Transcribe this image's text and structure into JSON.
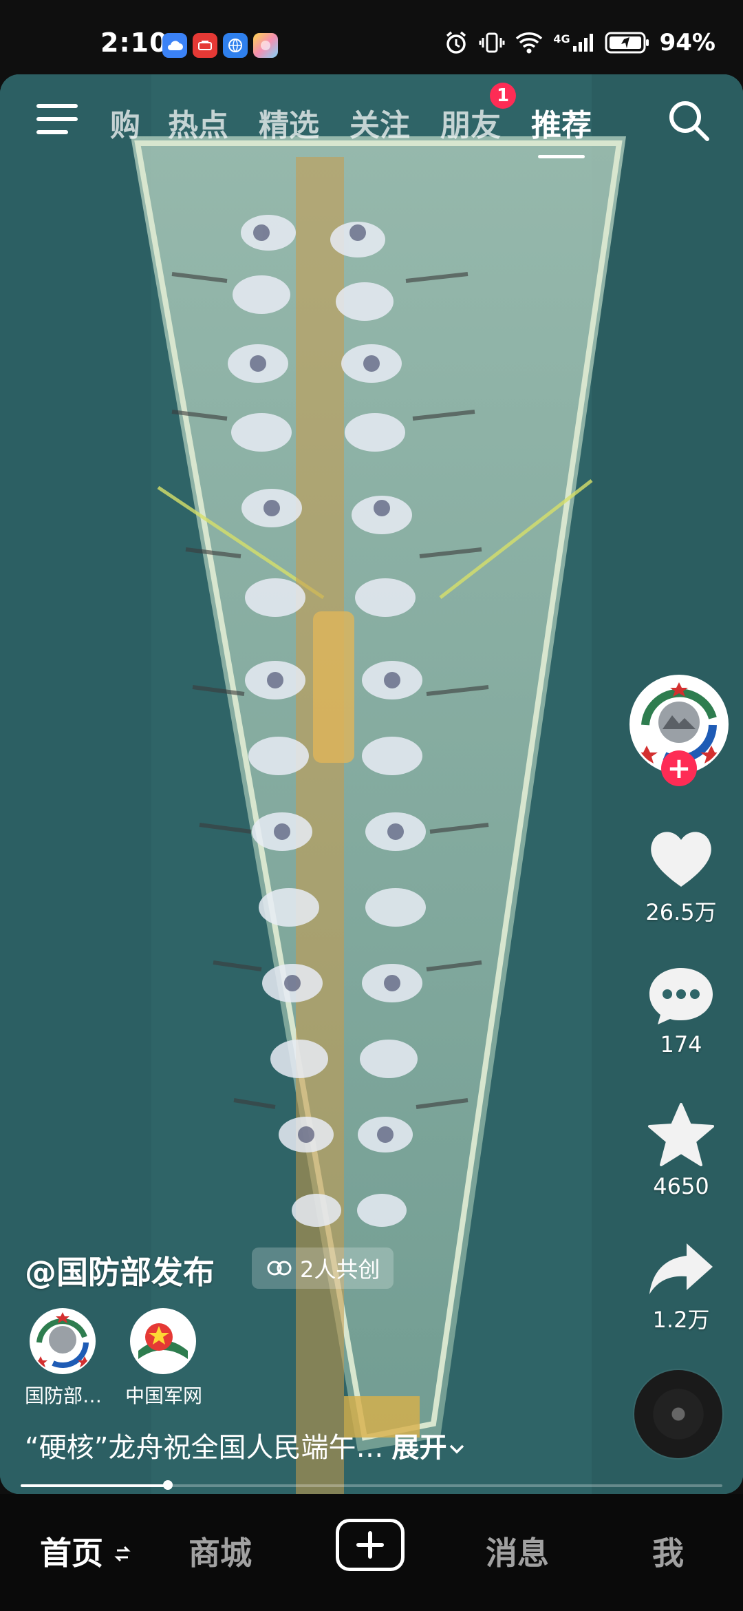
{
  "status_bar": {
    "time": "2:10",
    "battery": "94%",
    "network": "4G",
    "notification_icons": [
      "cloud-icon",
      "huawei-app-icon",
      "browser-icon",
      "gallery-icon"
    ]
  },
  "top_tabs": {
    "items": [
      "购",
      "热点",
      "精选",
      "关注",
      "朋友",
      "推荐"
    ],
    "active": "推荐",
    "friends_badge": "1"
  },
  "actions": {
    "likes": "26.5万",
    "comments": "174",
    "favorites": "4650",
    "shares": "1.2万"
  },
  "post": {
    "author": "@国防部发布",
    "cocreate_label": "2人共创",
    "co_creators": [
      "国防部…",
      "中国军网"
    ],
    "description": "“硬核”龙舟祝全国人民端午…",
    "expand_label": "展开",
    "progress": 0.21
  },
  "bottom_nav": {
    "home": "首页",
    "mall": "商城",
    "messages": "消息",
    "me": "我"
  },
  "colors": {
    "accent": "#fe2c55",
    "water": "#2f6568",
    "boat": "#c9d6c0"
  }
}
